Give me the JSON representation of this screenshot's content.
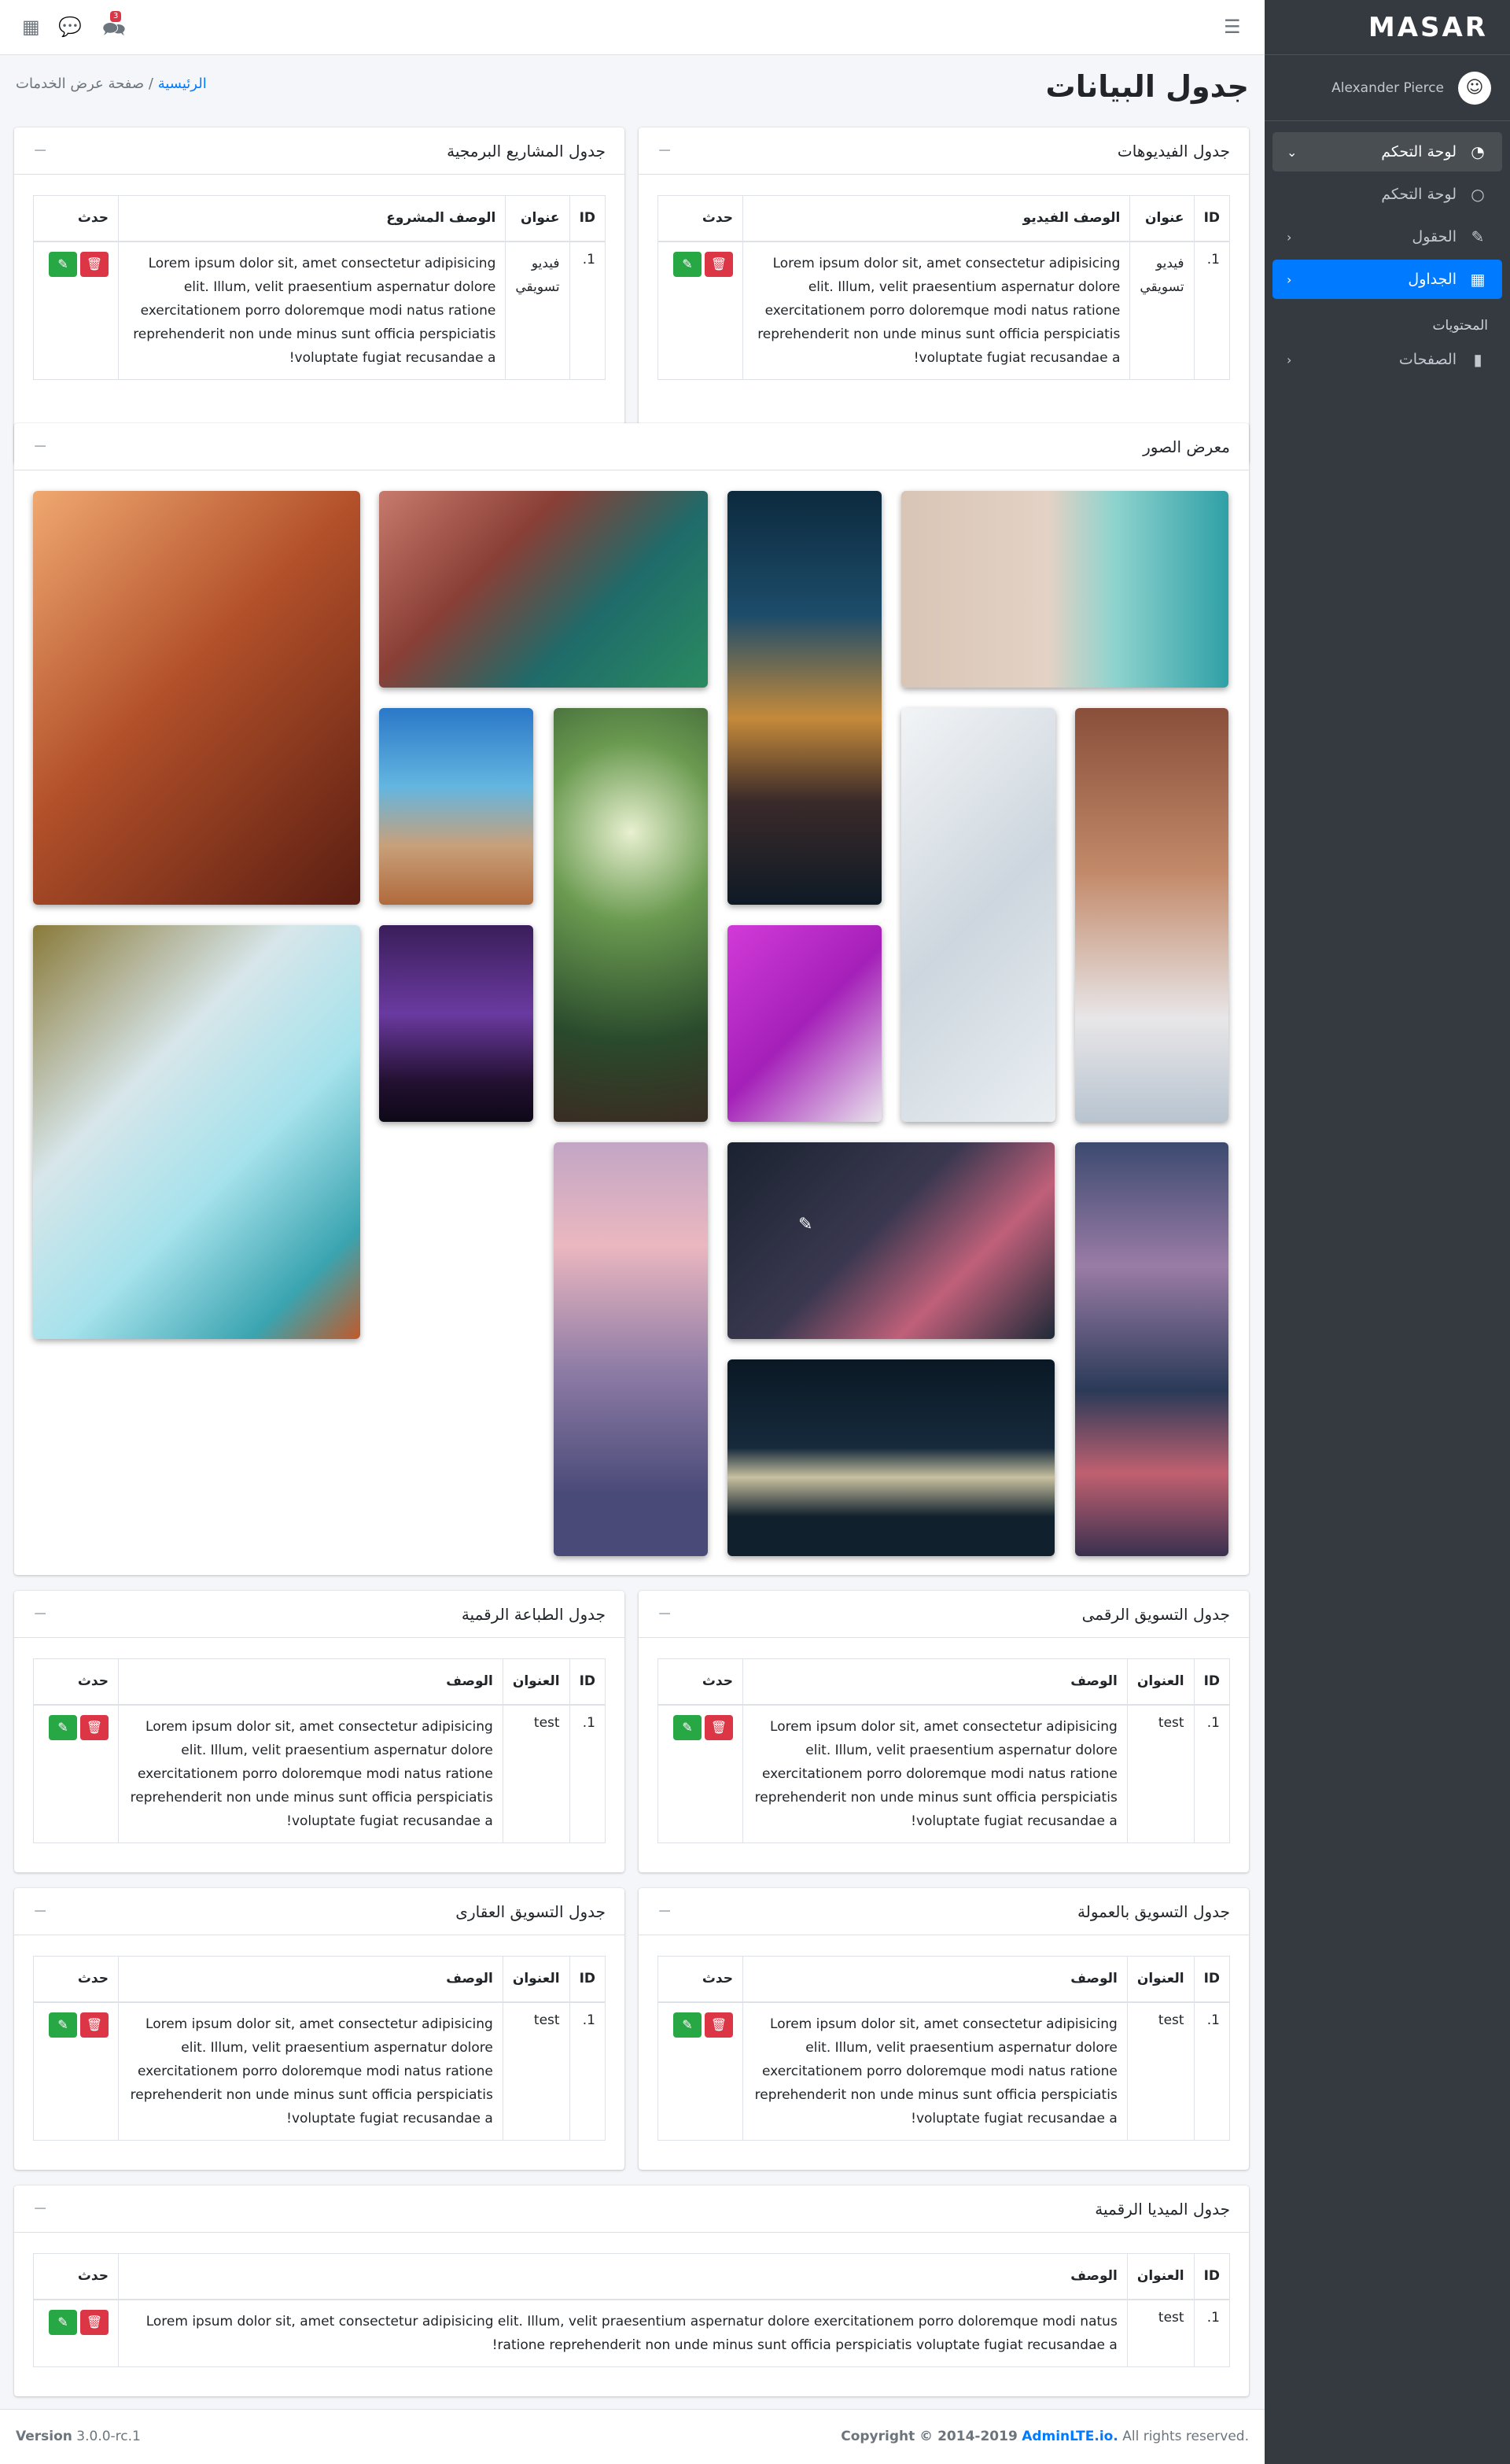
{
  "brand": {
    "logo": "MASAR"
  },
  "user": {
    "name": "Alexander Pierce"
  },
  "sidebar": {
    "items": [
      {
        "label": "لوحة التحكم",
        "icon": "tachometer-icon"
      },
      {
        "label": "لوحة التحكم",
        "icon": "circle-icon"
      },
      {
        "label": "الحقول",
        "icon": "edit-icon"
      },
      {
        "label": "الجداول",
        "icon": "table-icon"
      }
    ],
    "header": "المحتويات",
    "pages_label": "الصفحات"
  },
  "topnav": {
    "notif_count": "3"
  },
  "page": {
    "title": "جدول البيانات",
    "breadcrumb_home": "الرئيسية",
    "breadcrumb_current": "صفحة عرض الخدمات"
  },
  "lorem": "Lorem ipsum dolor sit, amet consectetur adipisicing elit. Illum, velit praesentium aspernatur dolore exercitationem porro doloremque modi natus ratione reprehenderit non unde minus sunt officia perspiciatis voluptate fugiat recusandae a!",
  "cards": {
    "videos": {
      "title": "جدول الفيديوهات",
      "headers": [
        "ID",
        "عنوان",
        "الوصف الفيديو",
        "حدث"
      ],
      "row": {
        "id": "1.",
        "title": "فيديو تسويقي"
      }
    },
    "projects": {
      "title": "جدول المشاريع البرمجية",
      "headers": [
        "ID",
        "عنوان",
        "الوصف المشروع",
        "حدث"
      ],
      "row": {
        "id": "1.",
        "title": "فيديو تسويقي"
      }
    },
    "gallery": {
      "title": "معرض الصور"
    },
    "digital_marketing": {
      "title": "جدول التسويق الرقمى",
      "headers": [
        "ID",
        "العنوان",
        "الوصف",
        "حدث"
      ],
      "row": {
        "id": "1.",
        "title": "test"
      }
    },
    "digital_printing": {
      "title": "جدول الطباعة الرقمية",
      "headers": [
        "ID",
        "العنوان",
        "الوصف",
        "حدث"
      ],
      "row": {
        "id": "1.",
        "title": "test"
      }
    },
    "affiliate": {
      "title": "جدول التسويق بالعمولة",
      "headers": [
        "ID",
        "العنوان",
        "الوصف",
        "حدث"
      ],
      "row": {
        "id": "1.",
        "title": "test"
      }
    },
    "real_estate": {
      "title": "جدول التسويق العقارى",
      "headers": [
        "ID",
        "العنوان",
        "الوصف",
        "حدث"
      ],
      "row": {
        "id": "1.",
        "title": "test"
      }
    },
    "digital_media": {
      "title": "جدول الميديا الرقمية",
      "headers": [
        "ID",
        "العنوان",
        "الوصف",
        "حدث"
      ],
      "row": {
        "id": "1.",
        "title": "test"
      }
    }
  },
  "footer": {
    "version_label": "Version",
    "version": "3.0.0-rc.1",
    "copyright": "Copyright © 2014-2019",
    "company": "AdminLTE.io.",
    "rights": "All rights reserved."
  },
  "colors": {
    "primary": "#007bff",
    "success": "#28a745",
    "danger": "#dc3545",
    "sidebar": "#343a40"
  }
}
